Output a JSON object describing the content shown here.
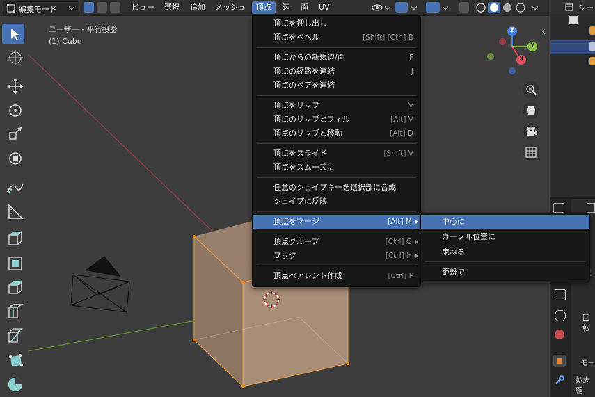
{
  "header": {
    "mode_label": "編集モード",
    "menus": [
      "ビュー",
      "選択",
      "追加",
      "メッシュ",
      "頂点",
      "辺",
      "面",
      "UV"
    ]
  },
  "viewport": {
    "view_name": "ユーザー・平行投影",
    "object_label": "(1) Cube",
    "gizmo_axes": {
      "z": "Z",
      "y": "Y",
      "x": "X"
    }
  },
  "vertex_menu": {
    "items": [
      {
        "label": "頂点を押し出し",
        "shortcut": ""
      },
      {
        "label": "頂点をベベル",
        "shortcut": "[Shift] [Ctrl] B"
      },
      {
        "label": "頂点からの新規辺/面",
        "shortcut": "F"
      },
      {
        "label": "頂点の経路を連結",
        "shortcut": "J"
      },
      {
        "label": "頂点のペアを連結",
        "shortcut": ""
      },
      {
        "label": "頂点をリップ",
        "shortcut": "V"
      },
      {
        "label": "頂点のリップとフィル",
        "shortcut": "[Alt] V"
      },
      {
        "label": "頂点のリップと移動",
        "shortcut": "[Alt] D"
      },
      {
        "label": "頂点をスライド",
        "shortcut": "[Shift] V"
      },
      {
        "label": "頂点をスムーズに",
        "shortcut": ""
      },
      {
        "label": "任意のシェイプキーを選択部に合成",
        "shortcut": ""
      },
      {
        "label": "シェイプに反映",
        "shortcut": ""
      },
      {
        "label": "頂点をマージ",
        "shortcut": "[Alt] M"
      },
      {
        "label": "頂点グループ",
        "shortcut": "[Ctrl] G"
      },
      {
        "label": "フック",
        "shortcut": "[Ctrl] H"
      },
      {
        "label": "頂点ペアレント作成",
        "shortcut": "[Ctrl] P"
      }
    ]
  },
  "merge_submenu": {
    "items": [
      {
        "label": "中心に"
      },
      {
        "label": "カーソル位置に"
      },
      {
        "label": "束ねる"
      },
      {
        "label": "距離で"
      }
    ]
  },
  "outliner": {
    "title": "シー"
  },
  "properties": {
    "labels": [
      "置",
      "回転",
      "モー",
      "拡大縮"
    ]
  },
  "colors": {
    "accent": "#4772b3",
    "menu_bg": "#181818",
    "cube": "#a08670",
    "axis_x": "#e04c5a",
    "axis_y": "#8bc34a",
    "axis_z": "#3f7fe0"
  }
}
